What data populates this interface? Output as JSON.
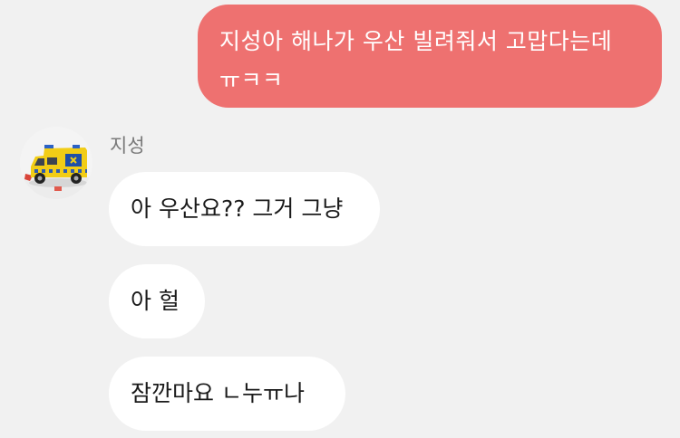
{
  "outgoing": {
    "lines": [
      "지성아 해나가 우산 빌려줘서 고맙다는데",
      "ㅠㅋㅋ"
    ]
  },
  "incoming": {
    "sender_name": "지성",
    "avatar_icon": "ambulance-toy-photo",
    "messages": [
      {
        "text": "아 우산요?? 그거 그냥"
      },
      {
        "text": "아 헐"
      },
      {
        "text": "잠깐마요 ㄴ누ㅠ나"
      }
    ]
  },
  "colors": {
    "background": "#f1f1f1",
    "outgoing_bubble": "#ee7170",
    "incoming_bubble": "#ffffff",
    "sender_name": "#7a7a7a"
  }
}
